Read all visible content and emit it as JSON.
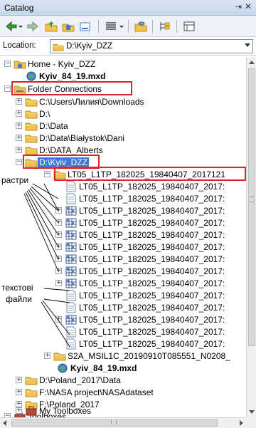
{
  "window": {
    "title": "Catalog",
    "pin_glyph": "⇥",
    "close_glyph": "✕"
  },
  "toolbar": {
    "buttons": [
      "back-icon",
      "forward-icon",
      "up-level-icon",
      "home-icon",
      "connect-folder-icon",
      "views-icon",
      "connect-database-icon",
      "toggle-contents-icon",
      "options-icon"
    ]
  },
  "location": {
    "label": "Location:",
    "value": "D:\\Kyiv_DZZ"
  },
  "tree": {
    "home": "Home - Kyiv_DZZ",
    "home_mxd": "Kyiv_84_19.mxd",
    "folder_connections": "Folder Connections",
    "downloads": "C:\\Users\\Лилия\\Downloads",
    "d_root": "D:\\",
    "d_data": "D:\\Data",
    "d_bialystok": "D:\\Data\\Białystok\\Dani",
    "d_alberts": "D:\\DATA_Alberts",
    "d_kyiv": "D:\\Kyiv_DZZ",
    "lt05_folder": "LT05_L1TP_182025_19840407_2017121",
    "items": [
      "LT05_L1TP_182025_19840407_2017:",
      "LT05_L1TP_182025_19840407_2017:",
      "LT05_L1TP_182025_19840407_2017:",
      "LT05_L1TP_182025_19840407_2017:",
      "LT05_L1TP_182025_19840407_2017:",
      "LT05_L1TP_182025_19840407_2017:",
      "LT05_L1TP_182025_19840407_2017:",
      "LT05_L1TP_182025_19840407_2017:",
      "LT05_L1TP_182025_19840407_2017:",
      "LT05_L1TP_182025_19840407_2017:",
      "LT05_L1TP_182025_19840407_2017:",
      "LT05_L1TP_182025_19840407_2017:",
      "LT05_L1TP_182025_19840407_2017:",
      "LT05_L1TP_182025_19840407_2017:"
    ],
    "s2a": "S2A_MSIL1C_20190910T085551_N0208_",
    "kyiv_mxd": "Kyiv_84_19.mxd",
    "d_poland": "D:\\Poland_2017\\Data",
    "nasa": "F:\\NASA project\\NASAdataset",
    "f_poland": "F:\\Poland_2017",
    "toolboxes": "Toolboxes",
    "my_toolboxes": "My Toolboxes"
  },
  "annotations": {
    "rasters": "растри",
    "text_files_1": "текстові",
    "text_files_2": "файли"
  },
  "colors": {
    "highlight": "#e3202b",
    "selection": "#3b7ad9",
    "folder": "#f0c44c"
  }
}
